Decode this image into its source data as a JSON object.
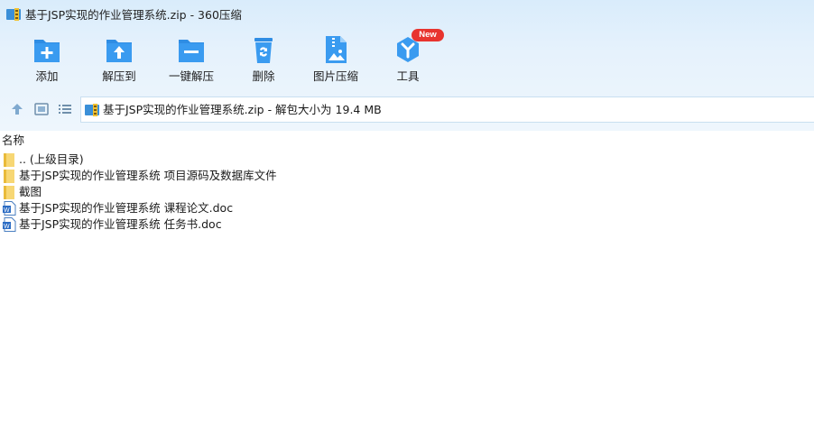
{
  "window": {
    "title": "基于JSP实现的作业管理系统.zip - 360压缩"
  },
  "toolbar": {
    "items": [
      {
        "label": "添加",
        "icon": "add-archive-icon"
      },
      {
        "label": "解压到",
        "icon": "extract-to-icon"
      },
      {
        "label": "一键解压",
        "icon": "one-click-extract-icon"
      },
      {
        "label": "删除",
        "icon": "delete-icon"
      },
      {
        "label": "图片压缩",
        "icon": "image-compress-icon"
      },
      {
        "label": "工具",
        "icon": "tools-icon",
        "badge": "New"
      }
    ]
  },
  "navbar": {
    "address_text": "基于JSP实现的作业管理系统.zip - 解包大小为 19.4 MB"
  },
  "list": {
    "column_name": "名称",
    "items": [
      {
        "name": ".. (上级目录)",
        "icon": "folder-icon"
      },
      {
        "name": "基于JSP实现的作业管理系统 项目源码及数据库文件",
        "icon": "folder-icon"
      },
      {
        "name": "截图",
        "icon": "folder-icon"
      },
      {
        "name": "基于JSP实现的作业管理系统 课程论文.doc",
        "icon": "word-doc-icon"
      },
      {
        "name": "基于JSP实现的作业管理系统 任务书.doc",
        "icon": "word-doc-icon"
      }
    ]
  },
  "colors": {
    "chrome_background": "#e3f0fc",
    "toolbar_icon_blue": "#2f8de4",
    "badge_red": "#e8342f",
    "folder_yellow": "#f7d774"
  }
}
